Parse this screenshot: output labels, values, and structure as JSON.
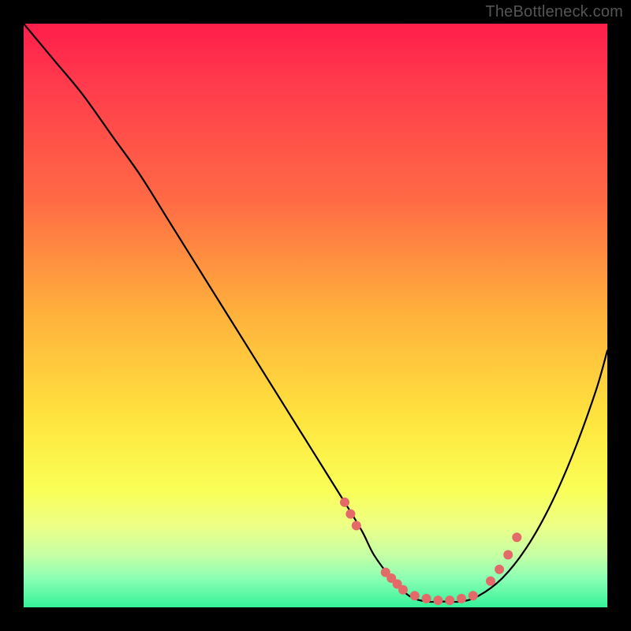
{
  "watermark": "TheBottleneck.com",
  "chart_data": {
    "type": "line",
    "title": "",
    "xlabel": "",
    "ylabel": "",
    "xlim": [
      0,
      100
    ],
    "ylim": [
      0,
      100
    ],
    "grid": false,
    "series": [
      {
        "name": "curve",
        "color": "#000000",
        "x": [
          0,
          5,
          10,
          15,
          20,
          25,
          30,
          35,
          40,
          45,
          50,
          55,
          58,
          60,
          63,
          66,
          69,
          72,
          75,
          78,
          82,
          86,
          90,
          94,
          98,
          100
        ],
        "y": [
          100,
          94,
          88,
          81,
          74,
          66,
          58,
          50,
          42,
          34,
          26,
          18,
          13,
          9,
          5,
          2,
          1,
          1,
          1,
          2,
          5,
          10,
          17,
          26,
          37,
          44
        ]
      }
    ],
    "markers": {
      "name": "dots",
      "color": "#e46a6a",
      "radius_px": 6,
      "x": [
        55,
        56,
        57,
        62,
        63,
        64,
        65,
        67,
        69,
        71,
        73,
        75,
        77,
        80,
        81.5,
        83,
        84.5
      ],
      "y": [
        18,
        16,
        14,
        6,
        5,
        4,
        3,
        2,
        1.5,
        1.2,
        1.2,
        1.5,
        2,
        4.5,
        6.5,
        9,
        12
      ]
    },
    "background_gradient": {
      "direction": "vertical",
      "stops": [
        {
          "pos": 0.0,
          "color": "#ff1e4b"
        },
        {
          "pos": 0.1,
          "color": "#ff3a4c"
        },
        {
          "pos": 0.3,
          "color": "#ff6a45"
        },
        {
          "pos": 0.5,
          "color": "#ffb23c"
        },
        {
          "pos": 0.68,
          "color": "#ffe53e"
        },
        {
          "pos": 0.8,
          "color": "#f9ff57"
        },
        {
          "pos": 0.86,
          "color": "#edff86"
        },
        {
          "pos": 0.91,
          "color": "#c6ffa5"
        },
        {
          "pos": 0.95,
          "color": "#8cffb4"
        },
        {
          "pos": 1.0,
          "color": "#35f29a"
        }
      ]
    }
  }
}
